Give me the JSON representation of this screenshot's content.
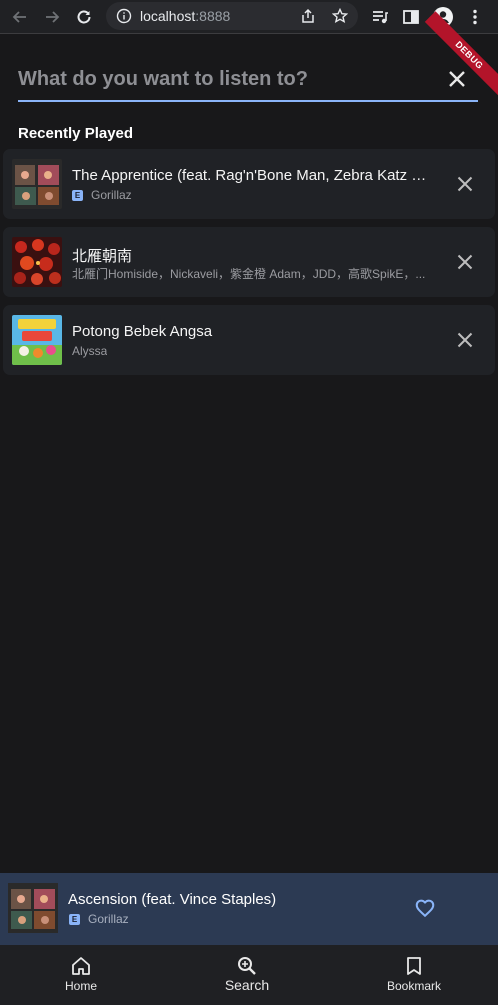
{
  "browser": {
    "url_host": "localhost",
    "url_port": ":8888"
  },
  "debug_banner": "DEBUG",
  "search": {
    "placeholder": "What do you want to listen to?"
  },
  "section": {
    "title": "Recently Played"
  },
  "recent": [
    {
      "title": "The Apprentice (feat. Rag'n'Bone Man, Zebra Katz & RAY BLK)",
      "artist": "Gorillaz",
      "explicit": true,
      "explicit_label": "E"
    },
    {
      "title": "北雁朝南",
      "artist": "北雁门Homiside，Nickaveli，紫金橙 Adam，JDD，高歌SpikE，...",
      "explicit": false
    },
    {
      "title": "Potong Bebek Angsa",
      "artist": "Alyssa",
      "explicit": false
    }
  ],
  "now_playing": {
    "title": "Ascension (feat. Vince Staples)",
    "artist": "Gorillaz",
    "explicit_label": "E"
  },
  "nav": {
    "home": "Home",
    "search": "Search",
    "bookmark": "Bookmark"
  },
  "colors": {
    "accent": "#8ab4f8",
    "background": "#18181a",
    "card": "#202226",
    "now_playing_bg": "#2c3a53"
  }
}
